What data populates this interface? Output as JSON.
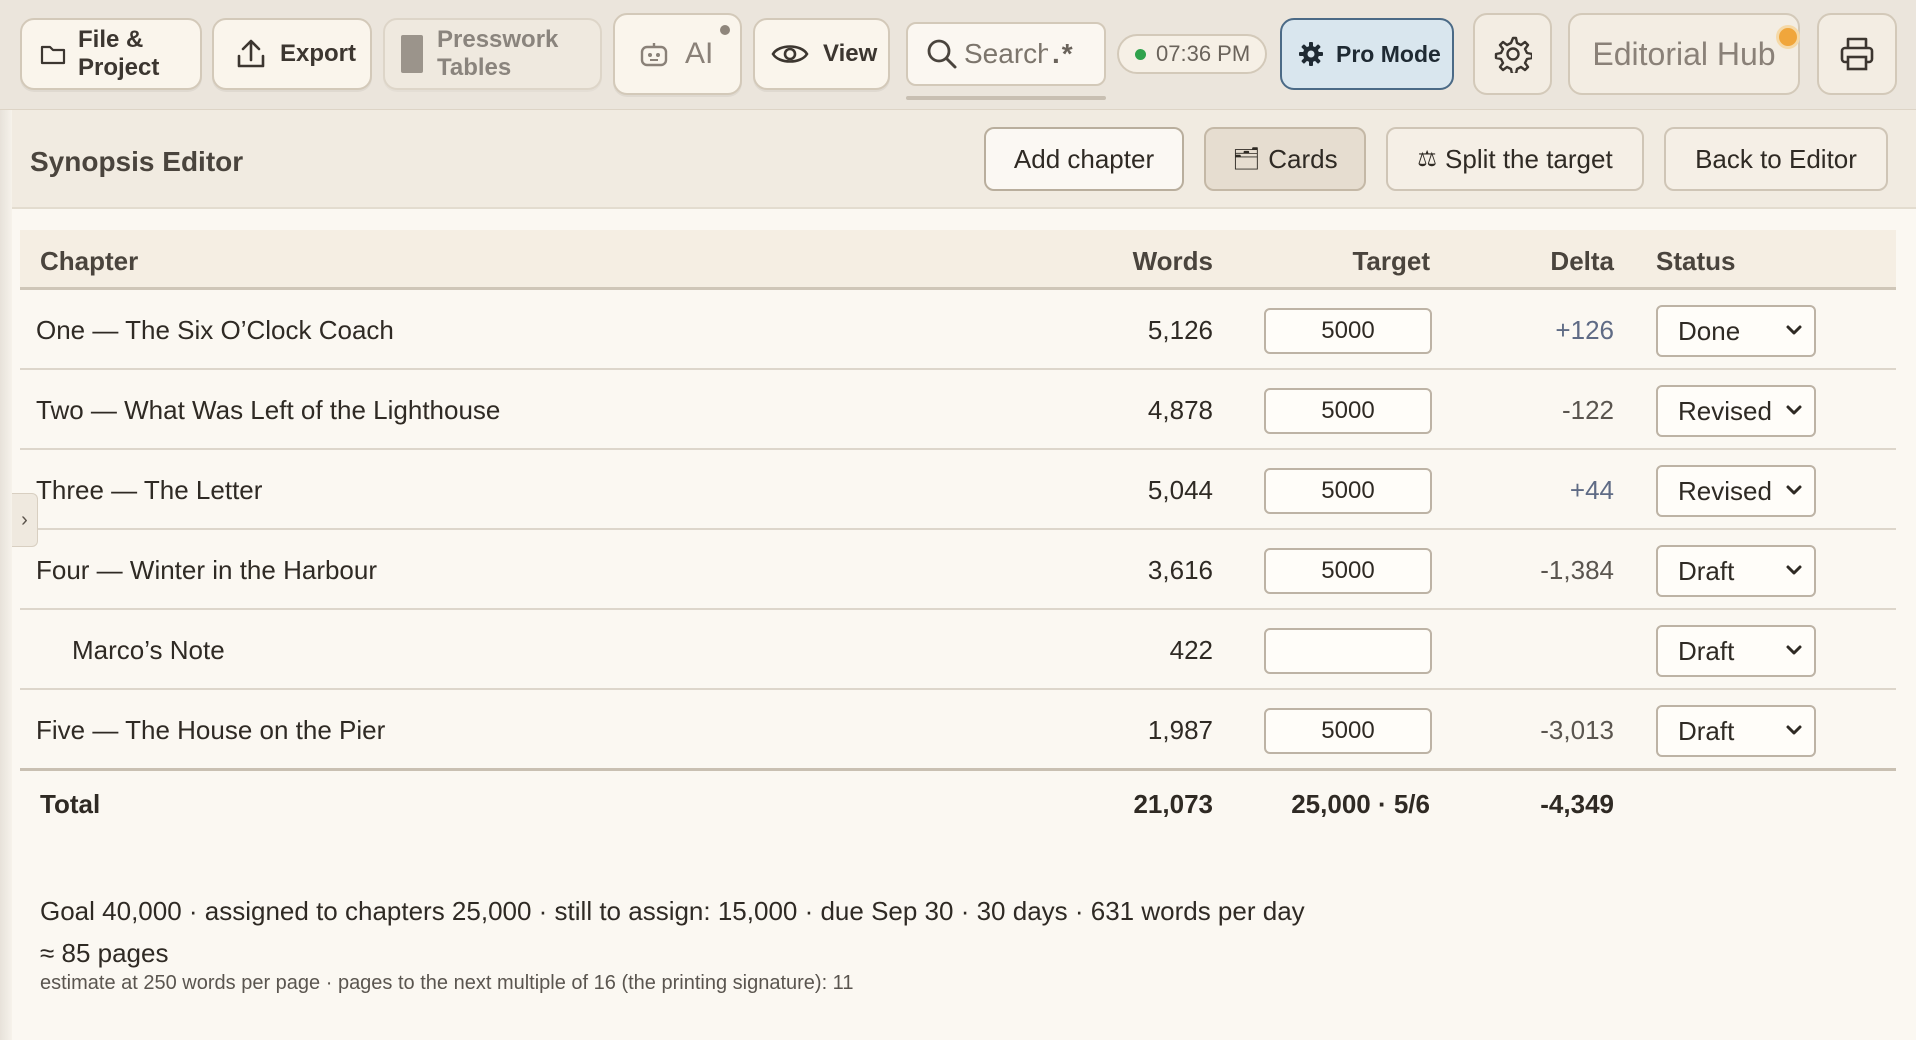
{
  "toolbar": {
    "file_label_1": "File &",
    "file_label_2": "Project",
    "export_label": "Export",
    "presswork_label_1": "Presswork",
    "presswork_label_2": "Tables",
    "ai_label": "AI",
    "view_label": "View",
    "search_placeholder": "Search",
    "regex_label": ".*",
    "clock_time": "07:36 PM",
    "pro_mode_label": "Pro Mode",
    "hub_label": "Editorial Hub"
  },
  "editor": {
    "title": "Synopsis Editor",
    "add_chapter_label": "Add chapter",
    "cards_label": "Cards",
    "split_label": "Split the target",
    "back_label": "Back to Editor"
  },
  "table": {
    "headers": {
      "chapter": "Chapter",
      "words": "Words",
      "target": "Target",
      "delta": "Delta",
      "status": "Status"
    },
    "rows": [
      {
        "chapter": "One — The Six O’Clock Coach",
        "words": "5,126",
        "target": "5000",
        "delta": "+126",
        "status": "Done"
      },
      {
        "chapter": "Two — What Was Left of the Lighthouse",
        "words": "4,878",
        "target": "5000",
        "delta": "-122",
        "status": "Revised"
      },
      {
        "chapter": "Three — The Letter",
        "words": "5,044",
        "target": "5000",
        "delta": "+44",
        "status": "Revised"
      },
      {
        "chapter": "Four — Winter in the Harbour",
        "words": "3,616",
        "target": "5000",
        "delta": "-1,384",
        "status": "Draft"
      },
      {
        "chapter": "Marco’s Note",
        "words": "422",
        "target": "",
        "delta": "",
        "status": "Draft"
      },
      {
        "chapter": "Five — The House on the Pier",
        "words": "1,987",
        "target": "5000",
        "delta": "-3,013",
        "status": "Draft"
      }
    ],
    "total": {
      "label": "Total",
      "words": "21,073",
      "target": "25,000 · 5/6",
      "delta": "-4,349"
    }
  },
  "summary": {
    "goal_line": "Goal 40,000 · assigned to chapters 25,000 · still to assign: 15,000 · due Sep 30 · 30 days · 631 words per day",
    "pages_line": "≈ 85 pages",
    "estimate_line": "estimate at 250 words per page · pages to the next multiple of 16 (the printing signature): 11"
  },
  "sidebar_toggle_label": "›"
}
